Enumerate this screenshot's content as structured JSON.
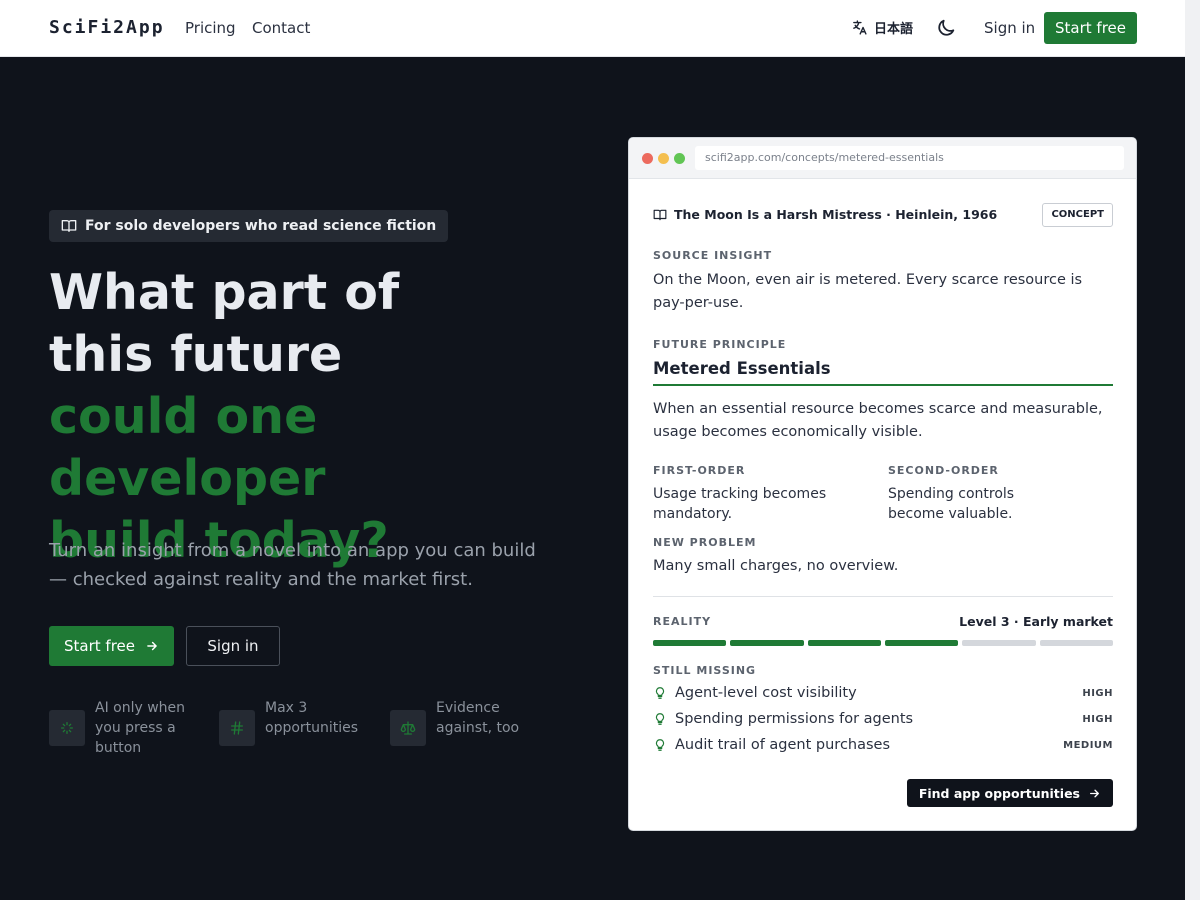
{
  "nav": {
    "brand": "SciFi2App",
    "links": [
      "Pricing",
      "Contact"
    ],
    "language": "日本語",
    "signin": "Sign in",
    "start": "Start free"
  },
  "hero": {
    "badge": "For solo developers who read science fiction",
    "headline_white": [
      "What part of",
      "this future"
    ],
    "headline_green": [
      "could one developer",
      "build today?"
    ],
    "subtitle": "Turn an insight from a novel into an app you can build — checked against reality and the market first.",
    "primary_btn": "Start free",
    "secondary_btn": "Sign in",
    "features": [
      {
        "icon": "sparkle-icon",
        "lines": [
          "AI only when",
          "you press a",
          "button"
        ]
      },
      {
        "icon": "hash-icon",
        "lines": [
          "Max 3",
          "opportunities"
        ]
      },
      {
        "icon": "scale-icon",
        "lines": [
          "Evidence",
          "against, too"
        ]
      }
    ]
  },
  "preview": {
    "url": "scifi2app.com/concepts/metered-essentials",
    "book": "The Moon Is a Harsh Mistress · Heinlein, 1966",
    "tag": "CONCEPT",
    "source_label": "SOURCE INSIGHT",
    "source_text": "On the Moon, even air is metered. Every scarce resource is pay-per-use.",
    "principle_label": "FUTURE PRINCIPLE",
    "principle": "Metered Essentials",
    "principle_text": "When an essential resource becomes scarce and measurable, usage becomes economically visible.",
    "first_label": "FIRST-ORDER",
    "first_text": "Usage tracking becomes mandatory.",
    "second_label": "SECOND-ORDER",
    "second_text": "Spending controls become valuable.",
    "problem_label": "NEW PROBLEM",
    "problem_text": "Many small charges, no overview.",
    "reality_label": "REALITY",
    "reality_level": "Level 3 · Early market",
    "reality_progress": 4,
    "reality_total": 6,
    "missing_label": "STILL MISSING",
    "missing": [
      {
        "text": "Agent-level cost visibility",
        "priority": "HIGH"
      },
      {
        "text": "Spending permissions for agents",
        "priority": "HIGH"
      },
      {
        "text": "Audit trail of agent purchases",
        "priority": "MEDIUM"
      }
    ],
    "cta": "Find app opportunities"
  },
  "colors": {
    "accent": "#1f7a35",
    "background": "#0f131b"
  }
}
